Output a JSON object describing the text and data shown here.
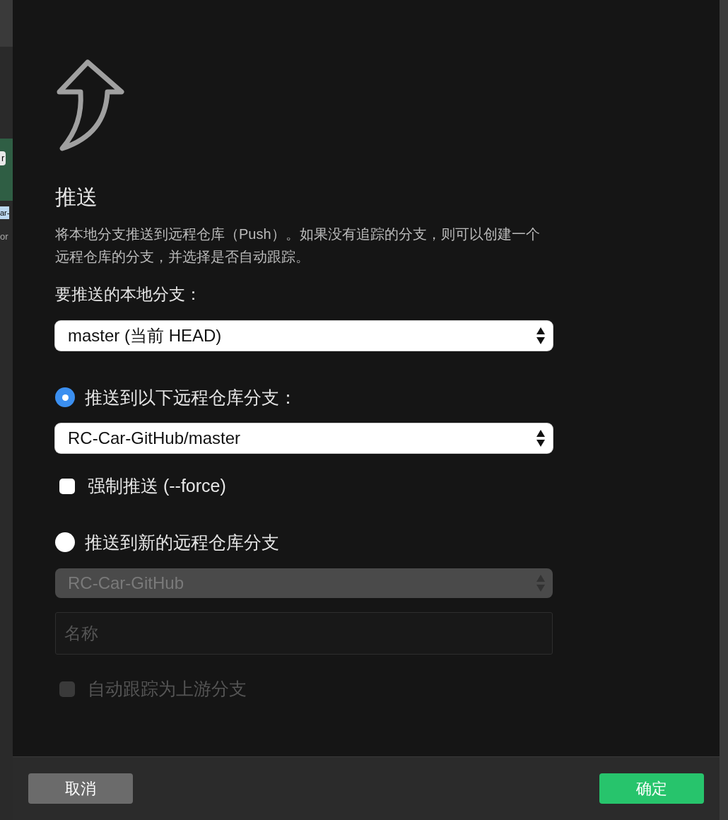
{
  "background": {
    "sidebar": [
      {
        "text": "r",
        "kind": "badge"
      },
      {
        "text": "ar-",
        "kind": "highlight"
      },
      {
        "text": "or",
        "kind": "plain"
      }
    ]
  },
  "dialog": {
    "title": "推送",
    "description": "将本地分支推送到远程仓库（Push）。如果没有追踪的分支，则可以创建一个远程仓库的分支，并选择是否自动跟踪。",
    "local_branch": {
      "label": "要推送的本地分支：",
      "value": "master (当前 HEAD)",
      "disabled": false
    },
    "targets": [
      {
        "label": "推送到以下远程仓库分支：",
        "selected": true,
        "controls": [
          {
            "kind": "select",
            "value": "RC-Car-GitHub/master",
            "disabled": false
          },
          {
            "kind": "checkbox",
            "label": "强制推送 (--force)",
            "checked": false,
            "disabled": false
          }
        ]
      },
      {
        "label": "推送到新的远程仓库分支",
        "selected": false,
        "controls": [
          {
            "kind": "select",
            "value": "RC-Car-GitHub",
            "disabled": true
          },
          {
            "kind": "input",
            "placeholder": "名称",
            "disabled": true
          },
          {
            "kind": "checkbox",
            "label": "自动跟踪为上游分支",
            "checked": false,
            "disabled": true
          }
        ]
      }
    ],
    "buttons": [
      {
        "label": "取消",
        "kind": "secondary"
      },
      {
        "label": "确定",
        "kind": "primary"
      }
    ]
  }
}
